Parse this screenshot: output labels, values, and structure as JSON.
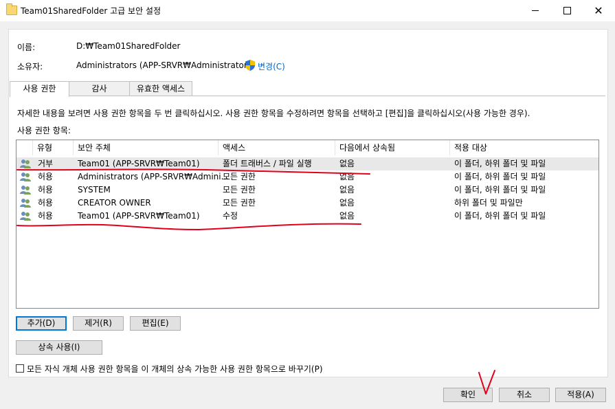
{
  "window": {
    "title": "Team01SharedFolder 고급 보안 설정",
    "min_label": "",
    "max_label": "",
    "close_label": "✕"
  },
  "info": {
    "name_label": "이름:",
    "name_value": "D:₩Team01SharedFolder",
    "owner_label": "소유자:",
    "owner_value": "Administrators (APP-SRVR₩Administrators)",
    "change_link": "변경(C)"
  },
  "tabs": [
    {
      "label": "사용 권한",
      "active": true
    },
    {
      "label": "감사",
      "active": false
    },
    {
      "label": "유효한 액세스",
      "active": false
    }
  ],
  "instructions": "자세한 내용을 보려면 사용 권한 항목을 두 번 클릭하십시오. 사용 권한 항목을 수정하려면 항목을 선택하고 [편집]을 클릭하십시오(사용 가능한 경우).",
  "entries_label": "사용 권한 항목:",
  "table": {
    "columns": [
      "유형",
      "보안 주체",
      "액세스",
      "다음에서 상속됨",
      "적용 대상"
    ],
    "rows": [
      {
        "type": "거부",
        "principal": "Team01 (APP-SRVR₩Team01)",
        "access": "폴더 트래버스 / 파일 실행",
        "inherited": "없음",
        "applies": "이 폴더, 하위 폴더 및 파일",
        "selected": true
      },
      {
        "type": "허용",
        "principal": "Administrators (APP-SRVR₩Admini...",
        "access": "모든 권한",
        "inherited": "없음",
        "applies": "이 폴더, 하위 폴더 및 파일",
        "selected": false
      },
      {
        "type": "허용",
        "principal": "SYSTEM",
        "access": "모든 권한",
        "inherited": "없음",
        "applies": "이 폴더, 하위 폴더 및 파일",
        "selected": false
      },
      {
        "type": "허용",
        "principal": "CREATOR OWNER",
        "access": "모든 권한",
        "inherited": "없음",
        "applies": "하위 폴더 및 파일만",
        "selected": false
      },
      {
        "type": "허용",
        "principal": "Team01 (APP-SRVR₩Team01)",
        "access": "수정",
        "inherited": "없음",
        "applies": "이 폴더, 하위 폴더 및 파일",
        "selected": false
      }
    ]
  },
  "buttons": {
    "add": "추가(D)",
    "remove": "제거(R)",
    "edit": "편집(E)",
    "inherit": "상속 사용(I)",
    "ok": "확인",
    "cancel": "취소",
    "apply": "적용(A)"
  },
  "replace_checkbox": {
    "label": "모든 자식 개체 사용 권한 항목을 이 개체의 상속 가능한 사용 권한 항목으로 바꾸기(P)",
    "checked": false
  },
  "colors": {
    "annotation": "#e0001b",
    "link": "#0066cc",
    "selection": "#e8e8e8"
  }
}
